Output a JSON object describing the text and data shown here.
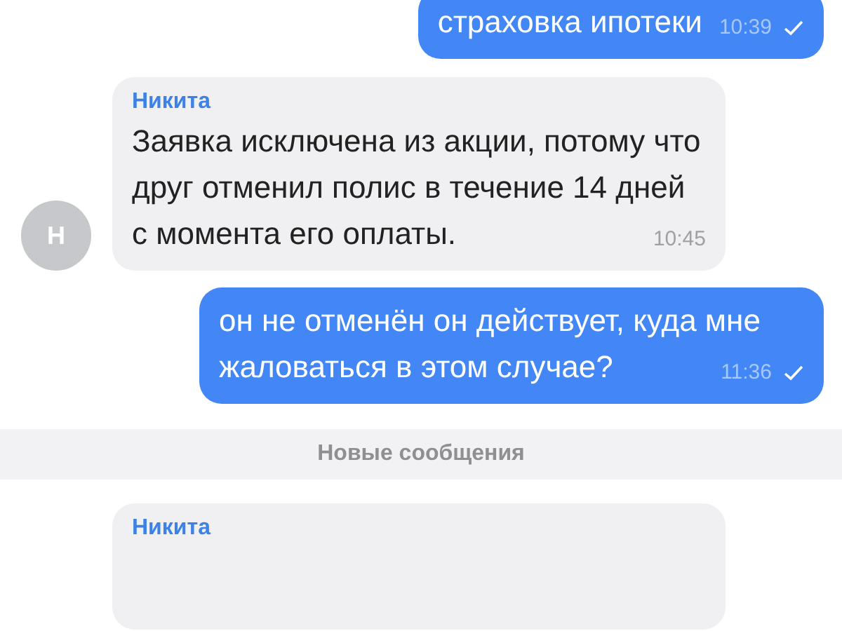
{
  "messages": [
    {
      "kind": "outgoing",
      "text": "страховка ипотеки",
      "time": "10:39"
    },
    {
      "kind": "incoming",
      "sender": "Никита",
      "text": "Заявка исключена из акции, потому что друг отменил полис в течение 14 дней с момента его оплаты.",
      "time": "10:45",
      "avatar": "Н"
    },
    {
      "kind": "outgoing",
      "text": "он не отменён он действует, куда мне жаловаться в этом случае?",
      "time": "11:36"
    },
    {
      "kind": "divider",
      "text": "Новые сообщения"
    },
    {
      "kind": "incoming",
      "sender": "Никита"
    }
  ]
}
